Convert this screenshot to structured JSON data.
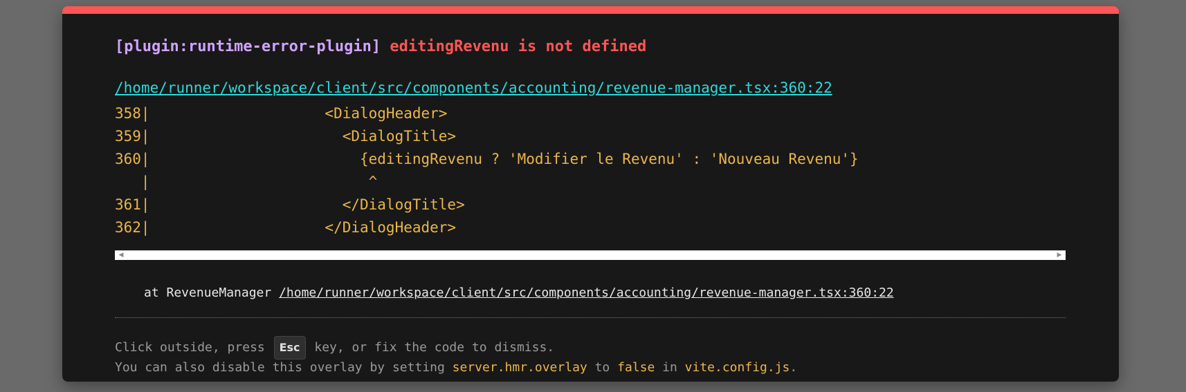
{
  "error": {
    "plugin": "[plugin:runtime-error-plugin]",
    "message": "editingRevenu is not defined",
    "file": "/home/runner/workspace/client/src/components/accounting/revenue-manager.tsx:360:22"
  },
  "code_frame": [
    "358|                    <DialogHeader>",
    "359|                      <DialogTitle>",
    "360|                        {editingRevenu ? 'Modifier le Revenu' : 'Nouveau Revenu'}",
    "   |                         ^",
    "361|                      </DialogTitle>",
    "362|                    </DialogHeader>"
  ],
  "stack": {
    "prefix": "at RevenueManager ",
    "location": "/home/runner/workspace/client/src/components/accounting/revenue-manager.tsx:360:22"
  },
  "tip": {
    "line1_before": "Click outside, press ",
    "key": "Esc",
    "line1_after": " key, or fix the code to dismiss.",
    "line2_a": "You can also disable this overlay by setting ",
    "line2_b": "server.hmr.overlay",
    "line2_c": " to ",
    "line2_d": "false",
    "line2_e": " in ",
    "line2_f": "vite.config.js",
    "line2_g": "."
  },
  "icons": {
    "scroll_left": "scroll-left-arrow-icon",
    "scroll_right": "scroll-right-arrow-icon"
  },
  "colors": {
    "accent_bar": "#ff5555",
    "plugin": "#cfa4ff",
    "message": "#ff5555",
    "file_link": "#2dd9da",
    "code": "#e9b64d"
  }
}
